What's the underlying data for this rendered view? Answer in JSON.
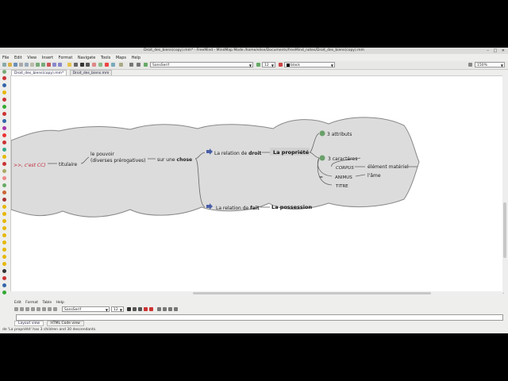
{
  "window": {
    "title": "Droit_des_biens(copy).mm* - FreeMind - MindMap Mode /home/elise/Documents/freeMind_notes/Droit_des_biens(copy).mm",
    "buttons": [
      "–",
      "□",
      "✕"
    ]
  },
  "menubar": [
    "File",
    "Edit",
    "View",
    "Insert",
    "Format",
    "Navigate",
    "Tools",
    "Maps",
    "Help"
  ],
  "toolbar": {
    "font": "SansSerif",
    "size": "12",
    "color": "black",
    "zoom": "150%"
  },
  "tabs": [
    "Droit_des_biens(copy).mm*",
    "Droit_des_biens.mm"
  ],
  "mindmap": {
    "left_text": ">>, c'est CC)",
    "titulaire": "titulaire",
    "pouvoir": [
      "le pouvoir",
      "(diverses prérogatives)"
    ],
    "sur_une": "sur une",
    "chose": "chose",
    "relation_droit_pre": "La relation de",
    "relation_droit_bold": "droit",
    "propriete": "La propriété",
    "attributs": "3 attributs",
    "caracteres": "3 caractères",
    "corpus": "CORPUS",
    "element": "élément matériel",
    "equals": "=",
    "animus": "ANIMUS",
    "ame": "l'âme",
    "titre": "TITRE",
    "relation_fait_pre": "La relation de",
    "relation_fait_bold": "fait",
    "possession": "La possession"
  },
  "editor": {
    "menu": [
      "Edit",
      "Format",
      "Table",
      "Help"
    ],
    "font": "SansSerif",
    "size": "12",
    "tabs": [
      "Layout view",
      "HTML Code view"
    ]
  },
  "status": "de 'La propriété' has 3 children and 30 descendants."
}
